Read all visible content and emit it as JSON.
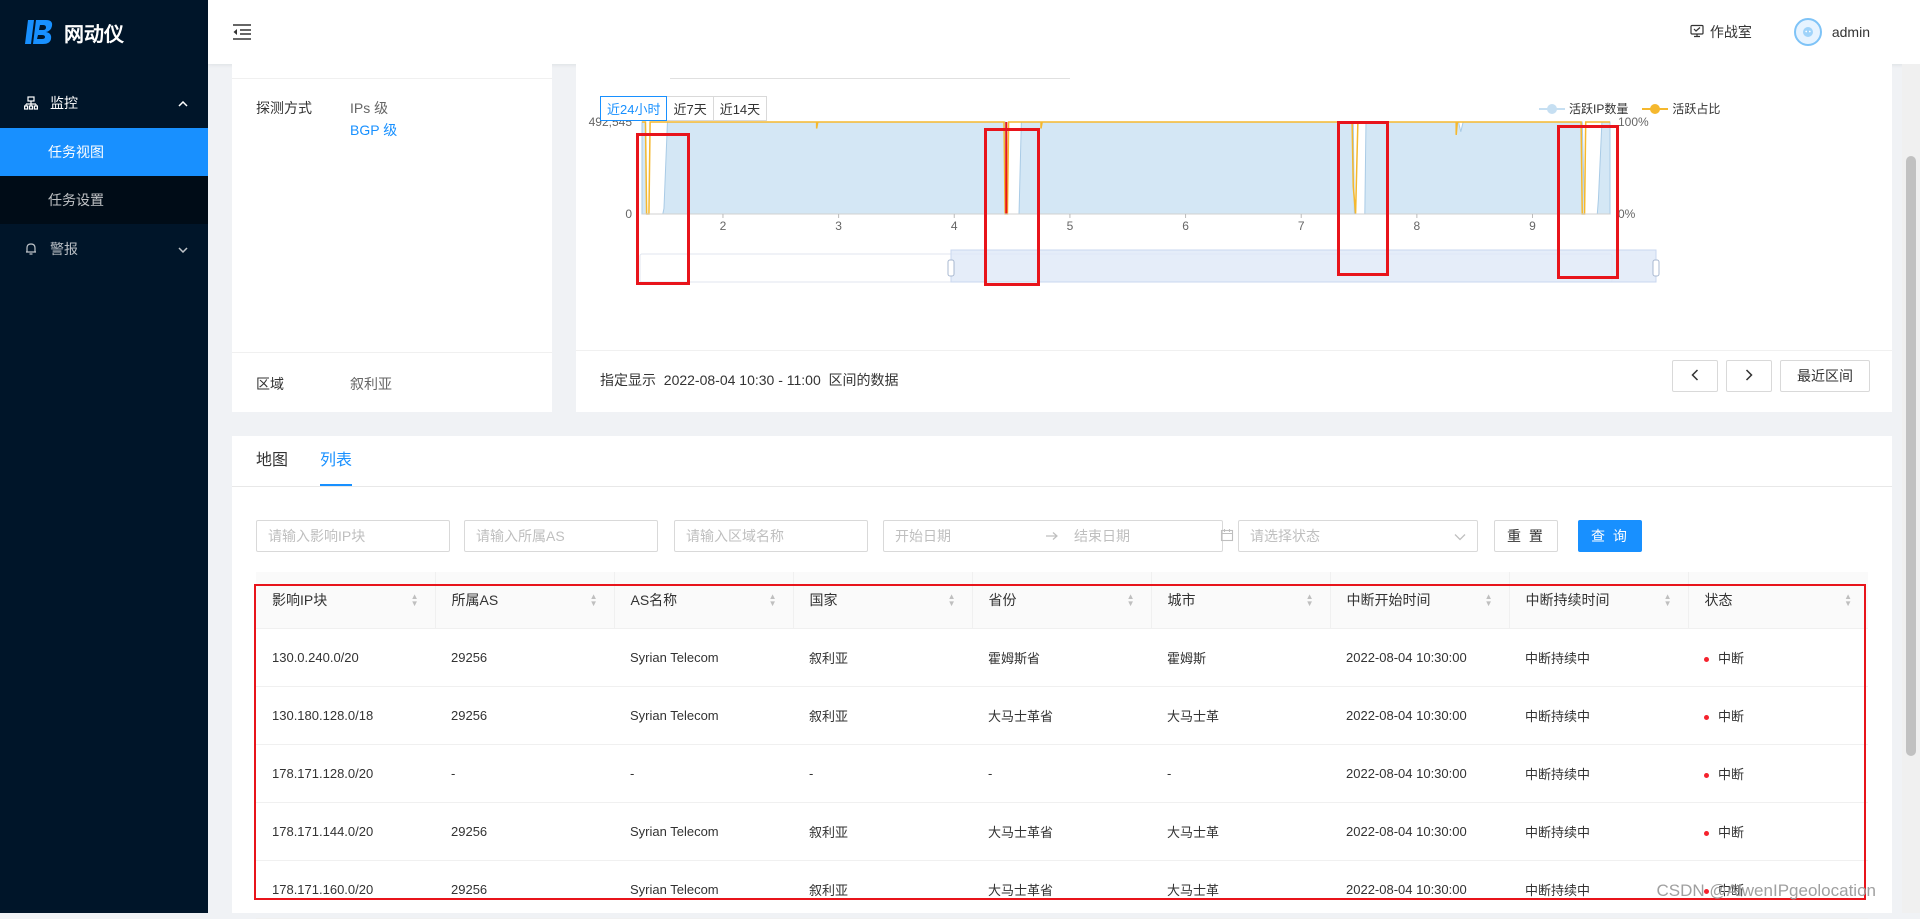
{
  "app": {
    "title": "网动仪"
  },
  "sidebar": {
    "groups": [
      {
        "label": "监控",
        "icon": "monitor-icon",
        "expanded": true,
        "items": [
          {
            "label": "任务视图",
            "active": true
          },
          {
            "label": "任务设置",
            "active": false
          }
        ]
      },
      {
        "label": "警报",
        "icon": "bell-icon",
        "expanded": false,
        "items": []
      }
    ]
  },
  "header": {
    "war_room": "作战室",
    "user": "admin"
  },
  "task_info": {
    "probe_method_label": "探测方式",
    "probe_methods": [
      "IPs 级",
      "BGP 级"
    ],
    "region_label": "区域",
    "region_value": "叙利亚"
  },
  "chart": {
    "range_tabs": [
      {
        "label": "近24小时",
        "active": true
      },
      {
        "label": "近7天",
        "active": false
      },
      {
        "label": "近14天",
        "active": false
      }
    ],
    "legend": [
      {
        "label": "活跃IP数量",
        "color": "#c6dff2"
      },
      {
        "label": "活跃占比",
        "color": "#f5b82e"
      }
    ],
    "specify_prefix": "指定显示",
    "specify_range": "2022-08-04 10:30 - 11:00",
    "specify_suffix": "区间的数据",
    "latest_button": "最近区间"
  },
  "chart_data": {
    "type": "area",
    "x_ticks": [
      "2",
      "3",
      "4",
      "5",
      "6",
      "7",
      "8",
      "9"
    ],
    "xlim": [
      1.3,
      9.67
    ],
    "y_left_ticks": [
      "0",
      "492,545"
    ],
    "y_left_lim": [
      0,
      492545
    ],
    "y_right_ticks": [
      "0%",
      "100%"
    ],
    "y_right_lim": [
      0,
      100
    ],
    "series": [
      {
        "name": "活跃IP数量",
        "axis": "left",
        "color": "#c6dff2",
        "points": [
          [
            1.3,
            492545
          ],
          [
            1.33,
            492545
          ],
          [
            1.34,
            0
          ],
          [
            1.48,
            0
          ],
          [
            1.49,
            30000
          ],
          [
            1.52,
            492545
          ],
          [
            4.44,
            492545
          ],
          [
            4.45,
            0
          ],
          [
            4.56,
            0
          ],
          [
            4.58,
            492545
          ],
          [
            7.45,
            492545
          ],
          [
            7.46,
            0
          ],
          [
            7.55,
            0
          ],
          [
            7.56,
            492545
          ],
          [
            8.36,
            492545
          ],
          [
            8.38,
            440000
          ],
          [
            8.4,
            492545
          ],
          [
            9.43,
            492545
          ],
          [
            9.45,
            0
          ],
          [
            9.56,
            0
          ],
          [
            9.57,
            80000
          ],
          [
            9.6,
            492545
          ],
          [
            9.67,
            492545
          ]
        ]
      },
      {
        "name": "活跃占比",
        "axis": "right",
        "color": "#f5b82e",
        "points": [
          [
            1.3,
            100
          ],
          [
            1.33,
            100
          ],
          [
            1.34,
            0
          ],
          [
            1.36,
            0
          ],
          [
            1.37,
            100
          ],
          [
            2.81,
            100
          ],
          [
            2.81,
            93
          ],
          [
            2.82,
            100
          ],
          [
            4.43,
            100
          ],
          [
            4.44,
            0
          ],
          [
            4.46,
            0
          ],
          [
            4.47,
            100
          ],
          [
            4.75,
            100
          ],
          [
            4.75,
            93
          ],
          [
            4.76,
            100
          ],
          [
            7.44,
            100
          ],
          [
            7.45,
            30
          ],
          [
            7.47,
            0
          ],
          [
            7.49,
            100
          ],
          [
            8.34,
            100
          ],
          [
            8.34,
            86
          ],
          [
            8.35,
            100
          ],
          [
            9.42,
            100
          ],
          [
            9.43,
            0
          ],
          [
            9.45,
            0
          ],
          [
            9.46,
            100
          ],
          [
            9.67,
            100
          ]
        ]
      }
    ],
    "highlighted_drops": [
      1.4,
      4.45,
      7.5,
      9.45
    ],
    "grid": false,
    "legend_position": "top-right"
  },
  "list": {
    "tabs": [
      {
        "label": "地图",
        "active": false
      },
      {
        "label": "列表",
        "active": true
      }
    ],
    "filters": {
      "ip_placeholder": "请输入影响IP块",
      "as_placeholder": "请输入所属AS",
      "region_placeholder": "请输入区域名称",
      "start_placeholder": "开始日期",
      "end_placeholder": "结束日期",
      "status_placeholder": "请选择状态",
      "reset": "重 置",
      "search": "查 询"
    },
    "columns": [
      "影响IP块",
      "所属AS",
      "AS名称",
      "国家",
      "省份",
      "城市",
      "中断开始时间",
      "中断持续时间",
      "状态"
    ],
    "rows": [
      [
        "130.0.240.0/20",
        "29256",
        "Syrian Telecom",
        "叙利亚",
        "霍姆斯省",
        "霍姆斯",
        "2022-08-04 10:30:00",
        "中断持续中",
        "中断"
      ],
      [
        "130.180.128.0/18",
        "29256",
        "Syrian Telecom",
        "叙利亚",
        "大马士革省",
        "大马士革",
        "2022-08-04 10:30:00",
        "中断持续中",
        "中断"
      ],
      [
        "178.171.128.0/20",
        "-",
        "-",
        "-",
        "-",
        "-",
        "2022-08-04 10:30:00",
        "中断持续中",
        "中断"
      ],
      [
        "178.171.144.0/20",
        "29256",
        "Syrian Telecom",
        "叙利亚",
        "大马士革省",
        "大马士革",
        "2022-08-04 10:30:00",
        "中断持续中",
        "中断"
      ],
      [
        "178.171.160.0/20",
        "29256",
        "Syrian Telecom",
        "叙利亚",
        "大马士革省",
        "大马士革",
        "2022-08-04 10:30:00",
        "中断持续中",
        "中断"
      ]
    ],
    "status_color": "#f5222d"
  },
  "watermark": "CSDN @AlwenIPgeolocation"
}
